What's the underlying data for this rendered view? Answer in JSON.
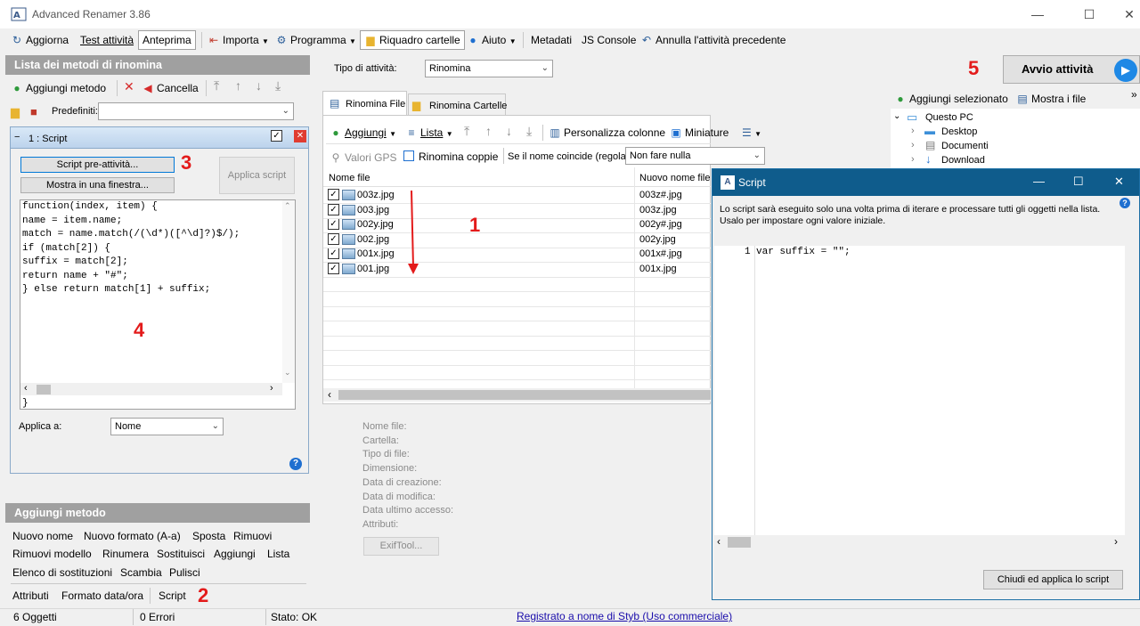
{
  "window": {
    "title": "Advanced Renamer 3.86",
    "min": "—",
    "max": "☐",
    "close": "✕"
  },
  "toolbar": {
    "refresh": "Aggiorna",
    "test": "Test attività",
    "preview": "Anteprima",
    "import": "Importa",
    "program": "Programma",
    "folders_panel": "Riquadro cartelle",
    "help": "Aiuto",
    "metadata": "Metadati",
    "js_console": "JS Console",
    "undo": "Annulla l'attività precedente"
  },
  "methods_panel": {
    "header": "Lista dei metodi di rinomina",
    "add_method": "Aggiungi metodo",
    "cancel": "Cancella",
    "presets_label": "Predefiniti:",
    "presets_value": ""
  },
  "script_method": {
    "title": "1 : Script",
    "pre_script_btn": "Script pre-attività...",
    "show_window_btn": "Mostra in una finestra...",
    "apply_script_btn": "Applica script",
    "code": "function(index, item) {\nname = item.name;\nmatch = name.match(/(\\d*)([^\\d]?)$/);\nif (match[2]) {\nsuffix = match[2];\nreturn name + \"#\";\n} else return match[1] + suffix;",
    "closing": "}",
    "apply_to_label": "Applica a:",
    "apply_to_value": "Nome"
  },
  "annotations": {
    "n1": "1",
    "n2": "2",
    "n3": "3",
    "n4": "4",
    "n5": "5"
  },
  "add_method_panel": {
    "header": "Aggiungi metodo",
    "row1": [
      "Nuovo nome",
      "Nuovo formato (A-a)",
      "Sposta",
      "Rimuovi"
    ],
    "row2": [
      "Rimuovi modello",
      "Rinumera",
      "Sostituisci",
      "Aggiungi",
      "Lista"
    ],
    "row3": [
      "Elenco di sostituzioni",
      "Scambia",
      "Pulisci"
    ],
    "row4": [
      "Attributi",
      "Formato data/ora",
      "Script"
    ]
  },
  "task": {
    "label": "Tipo di attività:",
    "value": "Rinomina"
  },
  "tabs": {
    "files": "Rinomina File",
    "folders": "Rinomina Cartelle"
  },
  "list_toolbar": {
    "add": "Aggiungi",
    "list": "Lista",
    "columns": "Personalizza colonne",
    "thumbs": "Miniature",
    "gps": "Valori GPS",
    "pairs": "Rinomina coppie",
    "match_label": "Se il nome coincide (regola):",
    "match_value": "Non fare nulla"
  },
  "file_table": {
    "col_name": "Nome file",
    "col_new": "Nuovo nome file",
    "rows": [
      {
        "name": "003z.jpg",
        "new": "003z#.jpg"
      },
      {
        "name": "003.jpg",
        "new": "003z.jpg"
      },
      {
        "name": "002y.jpg",
        "new": "002y#.jpg"
      },
      {
        "name": "002.jpg",
        "new": "002y.jpg"
      },
      {
        "name": "001x.jpg",
        "new": "001x#.jpg"
      },
      {
        "name": "001.jpg",
        "new": "001x.jpg"
      }
    ]
  },
  "file_info": {
    "fields": [
      "Nome file:",
      "Cartella:",
      "Tipo di file:",
      "Dimensione:",
      "Data di creazione:",
      "Data di modifica:",
      "Data ultimo accesso:",
      "Attributi:"
    ],
    "exiftool": "ExifTool..."
  },
  "start": {
    "label": "Avvio attività"
  },
  "folder_tree": {
    "add_selected": "Aggiungi selezionato",
    "show_files": "Mostra i file",
    "root": "Questo PC",
    "items": [
      "Desktop",
      "Documenti",
      "Download"
    ]
  },
  "dialog": {
    "title": "Script",
    "description": "Lo script sarà eseguito solo una volta prima di iterare e processare tutti gli oggetti nella lista.\nUsalo per impostare ogni valore iniziale.",
    "line_no": "1",
    "code": "var suffix = \"\";",
    "close_apply": "Chiudi ed applica lo script"
  },
  "status": {
    "objects": "6 Oggetti",
    "errors": "0 Errori",
    "state": "Stato: OK",
    "registered": "Registrato a nome di Styb (Uso commerciale)"
  },
  "colors": {
    "accent_red": "#e31b1b",
    "link_blue": "#1a0dab",
    "dialog_title": "#0f5c8c",
    "panel_header": "#a0a0a0",
    "start_blue": "#1e88e5"
  }
}
